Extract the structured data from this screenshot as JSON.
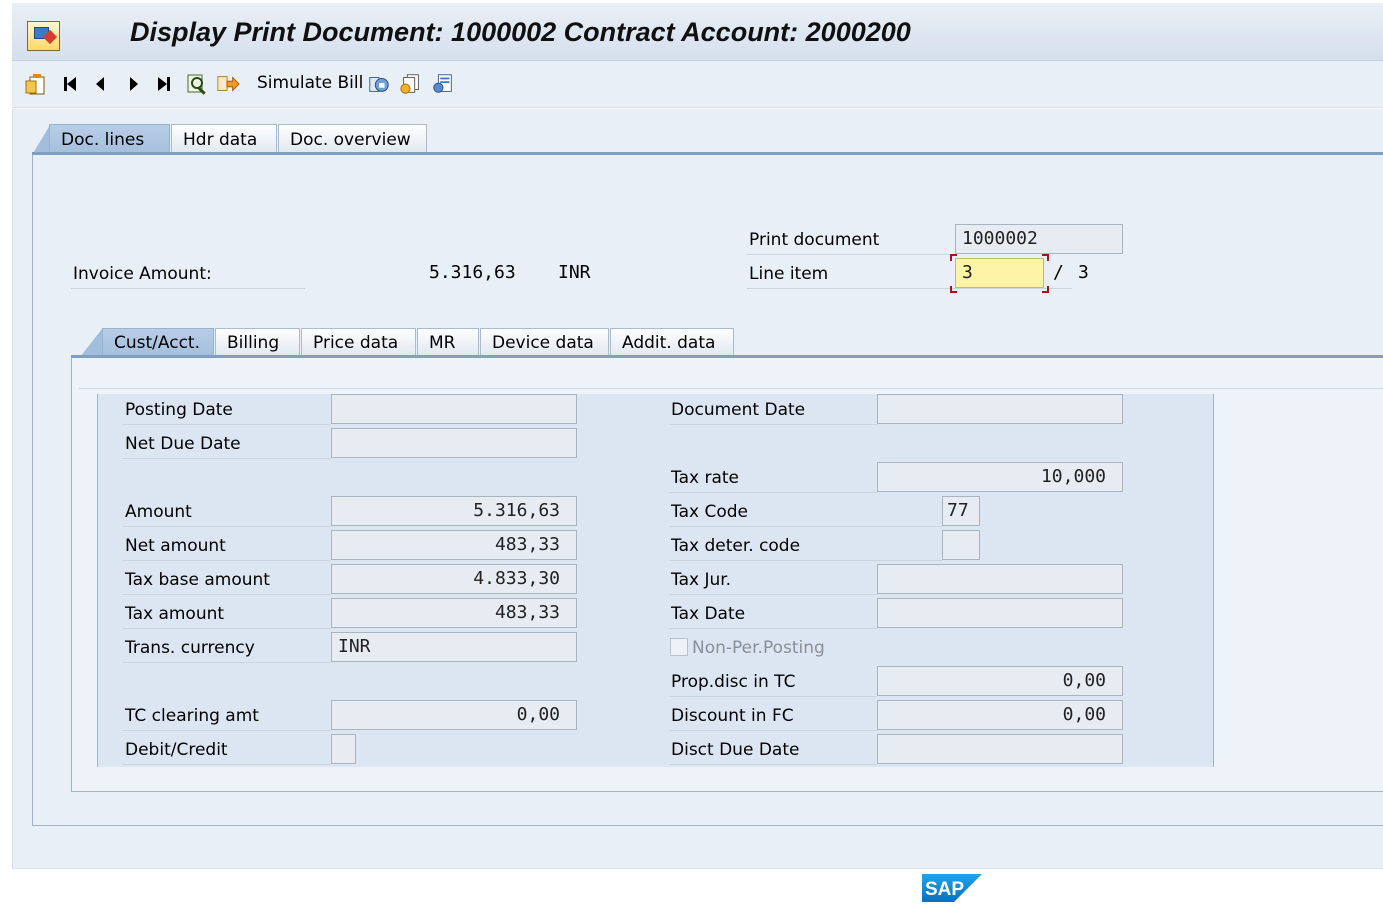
{
  "window": {
    "title": "Display Print Document: 1000002 Contract Account: 2000200"
  },
  "toolbar": {
    "icons": [
      "new-document-icon",
      "first-page-icon",
      "previous-page-icon",
      "next-page-icon",
      "last-page-icon",
      "find-icon",
      "navigate-icon",
      "copy-icon",
      "documents-icon",
      "configure-icon"
    ],
    "simulate_bill_label": "Simulate Bill"
  },
  "outer_tabs": [
    {
      "label": "Doc. lines",
      "active": true
    },
    {
      "label": "Hdr data",
      "active": false
    },
    {
      "label": "Doc. overview",
      "active": false
    }
  ],
  "header": {
    "invoice_amount_label": "Invoice Amount:",
    "invoice_amount_value": "5.316,63",
    "invoice_currency": "INR",
    "print_document_label": "Print document",
    "print_document_value": "1000002",
    "line_item_label": "Line item",
    "line_item_value": "3",
    "line_item_separator": "/",
    "line_item_total": "3"
  },
  "inner_tabs": [
    {
      "label": "Cust/Acct.",
      "active": true
    },
    {
      "label": "Billing",
      "active": false
    },
    {
      "label": "Price data",
      "active": false
    },
    {
      "label": "MR",
      "active": false
    },
    {
      "label": "Device data",
      "active": false
    },
    {
      "label": "Addit. data",
      "active": false
    }
  ],
  "left_fields": {
    "posting_date": {
      "label": "Posting Date",
      "value": ""
    },
    "net_due_date": {
      "label": "Net Due Date",
      "value": ""
    },
    "amount": {
      "label": "Amount",
      "value": "5.316,63"
    },
    "net_amount": {
      "label": "Net amount",
      "value": "483,33"
    },
    "tax_base_amount": {
      "label": "Tax base amount",
      "value": "4.833,30"
    },
    "tax_amount": {
      "label": "Tax amount",
      "value": "483,33"
    },
    "trans_currency": {
      "label": "Trans. currency",
      "value": "INR"
    },
    "tc_clearing_amt": {
      "label": "TC clearing amt",
      "value": "0,00"
    },
    "debit_credit": {
      "label": "Debit/Credit",
      "value": ""
    }
  },
  "right_fields": {
    "document_date": {
      "label": "Document Date",
      "value": ""
    },
    "tax_rate": {
      "label": "Tax rate",
      "value": "10,000"
    },
    "tax_code": {
      "label": "Tax Code",
      "value": "77"
    },
    "tax_deter_code": {
      "label": "Tax deter. code",
      "value": ""
    },
    "tax_jur": {
      "label": "Tax Jur.",
      "value": ""
    },
    "tax_date": {
      "label": "Tax Date",
      "value": ""
    },
    "non_per_posting": {
      "label": "Non-Per.Posting",
      "checked": false
    },
    "prop_disc_in_tc": {
      "label": "Prop.disc in TC",
      "value": "0,00"
    },
    "discount_in_fc": {
      "label": "Discount in FC",
      "value": "0,00"
    },
    "disct_due_date": {
      "label": "Disct Due Date",
      "value": ""
    }
  },
  "footer": {
    "logo": "SAP"
  },
  "colors": {
    "title_bg": "#dde6f0",
    "active_tab": "#a3bedc",
    "panel_bg": "#e8eff7",
    "editable_field": "#fdf4a8",
    "sap_blue": "#1a8fd8"
  }
}
